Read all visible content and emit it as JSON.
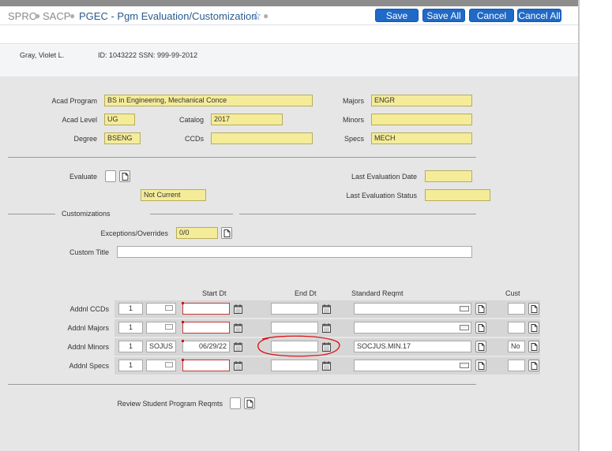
{
  "breadcrumb": {
    "item1": "SPRO",
    "item2": "SACP",
    "page_title": "PGEC - Pgm Evaluation/Customization"
  },
  "toolbar": {
    "save": "Save",
    "save_all": "Save All",
    "cancel": "Cancel",
    "cancel_all": "Cancel All"
  },
  "student": {
    "name": "Gray,  Violet L.",
    "ids": "ID: 1043222 SSN: 999-99-2012"
  },
  "program": {
    "acad_program_label": "Acad Program",
    "acad_program": "BS in Engineering, Mechanical Conce",
    "majors_label": "Majors",
    "majors": "ENGR",
    "acad_level_label": "Acad Level",
    "acad_level": "UG",
    "catalog_label": "Catalog",
    "catalog": "2017",
    "minors_label": "Minors",
    "minors": "",
    "degree_label": "Degree",
    "degree": "BSENG",
    "ccds_label": "CCDs",
    "ccds": "",
    "specs_label": "Specs",
    "specs": "MECH"
  },
  "evaluation": {
    "evaluate_label": "Evaluate",
    "status_text": "Not Current",
    "last_eval_date_label": "Last Evaluation Date",
    "last_eval_date": "",
    "last_eval_status_label": "Last Evaluation Status",
    "last_eval_status": ""
  },
  "customizations": {
    "section_label": "Customizations",
    "exceptions_label": "Exceptions/Overrides",
    "exceptions_value": "0/0",
    "custom_title_label": "Custom Title",
    "custom_title": ""
  },
  "grid": {
    "headers": {
      "start": "Start Dt",
      "end": "End Dt",
      "reqmt": "Standard Reqmt",
      "cust": "Cust"
    },
    "rows": [
      {
        "label": "Addnl CCDs",
        "num": "1",
        "code": "",
        "start": "",
        "end": "",
        "reqmt": "",
        "cust": ""
      },
      {
        "label": "Addnl Majors",
        "num": "1",
        "code": "",
        "start": "",
        "end": "",
        "reqmt": "",
        "cust": ""
      },
      {
        "label": "Addnl Minors",
        "num": "1",
        "code": "SOJUS",
        "start": "06/29/22",
        "end": "",
        "reqmt": "SOCJUS.MIN.17",
        "cust": "No"
      },
      {
        "label": "Addnl Specs",
        "num": "1",
        "code": "",
        "start": "",
        "end": "",
        "reqmt": "",
        "cust": ""
      }
    ]
  },
  "review": {
    "label": "Review Student Program Reqmts"
  },
  "colors": {
    "accent": "#1f69c7",
    "field_yellow": "#f5ec9a",
    "annotation_red": "#d11"
  }
}
